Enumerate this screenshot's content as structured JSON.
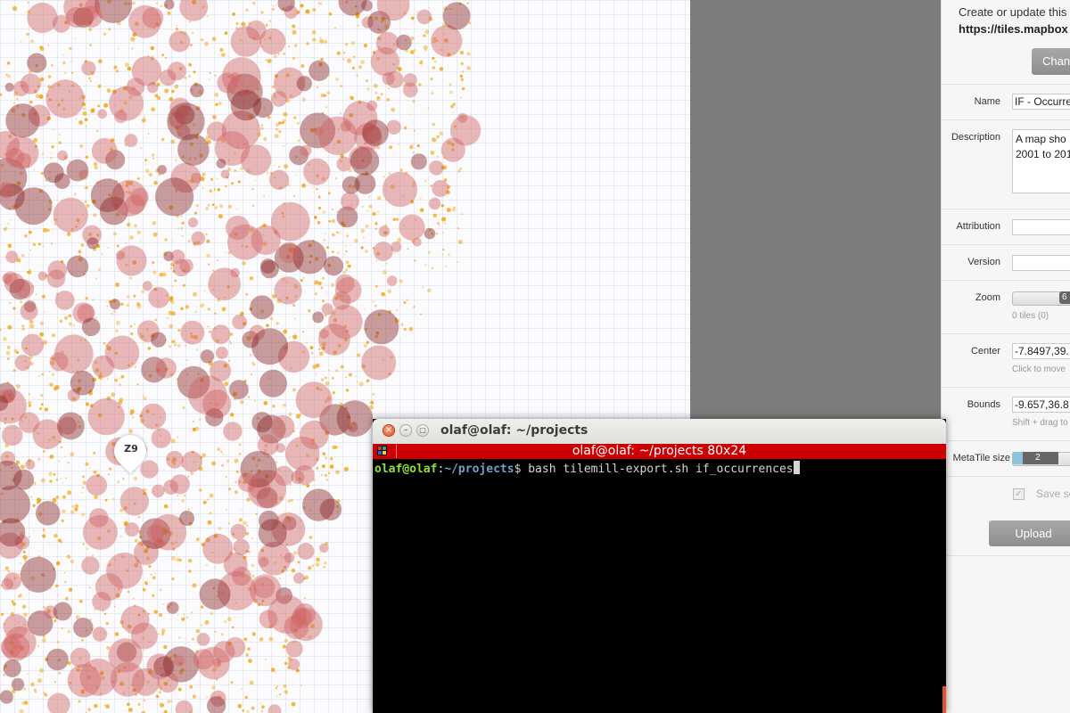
{
  "map": {
    "zoom_marker": "Z9",
    "colors": {
      "large_circle_light": "#cf6464",
      "large_circle_dark": "#8a2828",
      "small_dot": "#f0a000",
      "background": "#fbfbfd"
    }
  },
  "panel": {
    "intro_text": "Create or update this",
    "intro_url": "https://tiles.mapbox",
    "change_button": "Chang",
    "name_label": "Name",
    "name_value": "IF - Occurre",
    "description_label": "Description",
    "description_value": "A map sho 2001 to 201",
    "attribution_label": "Attribution",
    "attribution_value": "",
    "version_label": "Version",
    "version_value": "",
    "zoom_label": "Zoom",
    "zoom_value": "6",
    "zoom_hint": "0 tiles (0)",
    "center_label": "Center",
    "center_value": "-7.8497,39.",
    "center_hint": "Click to move",
    "bounds_label": "Bounds",
    "bounds_value": "-9.657,36.8",
    "bounds_hint": "Shift + drag to",
    "metatile_label": "MetaTile size",
    "metatile_value": "2",
    "save_label": "Save se",
    "upload_button": "Upload"
  },
  "terminal": {
    "window_title": "olaf@olaf: ~/projects",
    "header_title": "olaf@olaf: ~/projects 80x24",
    "prompt_user": "olaf@olaf",
    "prompt_sep": ":",
    "prompt_path": "~/projects",
    "prompt_symbol": "$",
    "command": " bash tilemill-export.sh if_occurrences"
  }
}
